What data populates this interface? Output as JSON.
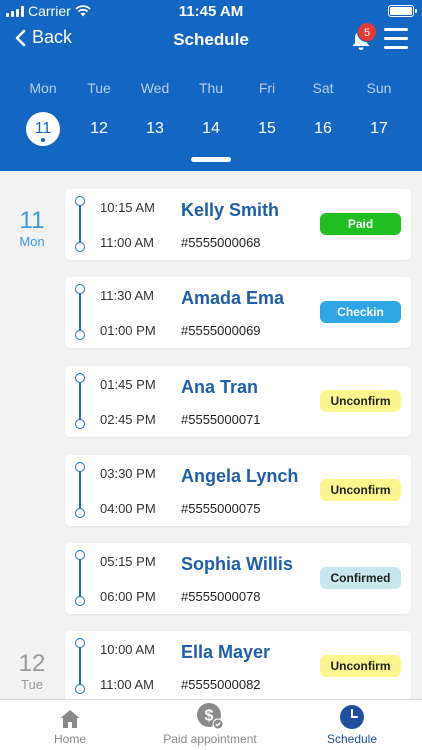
{
  "status_bar": {
    "carrier": "Carrier",
    "time": "11:45 AM"
  },
  "nav": {
    "back_label": "Back",
    "title": "Schedule",
    "notification_count": "5"
  },
  "week": [
    {
      "name": "Mon",
      "date": "11",
      "selected": true
    },
    {
      "name": "Tue",
      "date": "12",
      "selected": false
    },
    {
      "name": "Wed",
      "date": "13",
      "selected": false
    },
    {
      "name": "Thu",
      "date": "14",
      "selected": false
    },
    {
      "name": "Fri",
      "date": "15",
      "selected": false
    },
    {
      "name": "Sat",
      "date": "16",
      "selected": false
    },
    {
      "name": "Sun",
      "date": "17",
      "selected": false
    }
  ],
  "groups": [
    {
      "date": "11",
      "weekday": "Mon"
    },
    {
      "date": "12",
      "weekday": "Tue"
    }
  ],
  "appointments": [
    {
      "start": "10:15 AM",
      "end": "11:00 AM",
      "name": "Kelly Smith",
      "code": "#5555000068",
      "status": "Paid"
    },
    {
      "start": "11:30 AM",
      "end": "01:00 PM",
      "name": "Amada Ema",
      "code": "#5555000069",
      "status": "Checkin"
    },
    {
      "start": "01:45 PM",
      "end": "02:45 PM",
      "name": "Ana Tran",
      "code": "#5555000071",
      "status": "Unconfirm"
    },
    {
      "start": "03:30 PM",
      "end": "04:00 PM",
      "name": "Angela Lynch",
      "code": "#5555000075",
      "status": "Unconfirm"
    },
    {
      "start": "05:15 PM",
      "end": "06:00 PM",
      "name": "Sophia Willis",
      "code": "#5555000078",
      "status": "Confirmed"
    },
    {
      "start": "10:00 AM",
      "end": "11:00 AM",
      "name": "Ella Mayer",
      "code": "#5555000082",
      "status": "Unconfirm"
    }
  ],
  "tabs": [
    {
      "label": "Home",
      "icon": "home-icon",
      "active": false
    },
    {
      "label": "Paid appointment",
      "icon": "dollar-check-icon",
      "active": false
    },
    {
      "label": "Schedule",
      "icon": "clock-icon",
      "active": true
    }
  ],
  "colors": {
    "header_blue": "#1366c2",
    "paid": "#1fbe21",
    "checkin": "#2ea6e3",
    "unconfirm": "#fbf68d",
    "confirmed": "#c8e6ee",
    "name_blue": "#1f5fa8"
  }
}
